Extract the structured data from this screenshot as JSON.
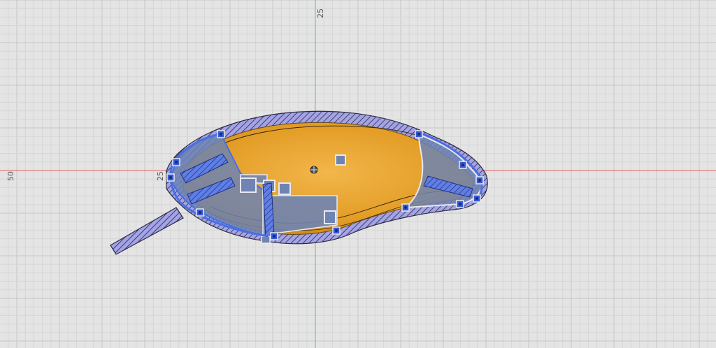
{
  "viewport": {
    "axis_labels": {
      "top": "25",
      "left": "50",
      "inner": "25"
    },
    "colors": {
      "background": "#e4e4e4",
      "grid_minor": "#d5d5d5",
      "grid_major": "#c4c4c4",
      "x_axis": "#e06060",
      "y_axis": "#66c266",
      "body_fill": "#e7a02a",
      "selection": "#4a6fe0",
      "selection_fill": "#6f84b2",
      "hatch": "#9c9ce0",
      "hatch_line": "#2a2a40",
      "point": "#3559d6"
    }
  }
}
